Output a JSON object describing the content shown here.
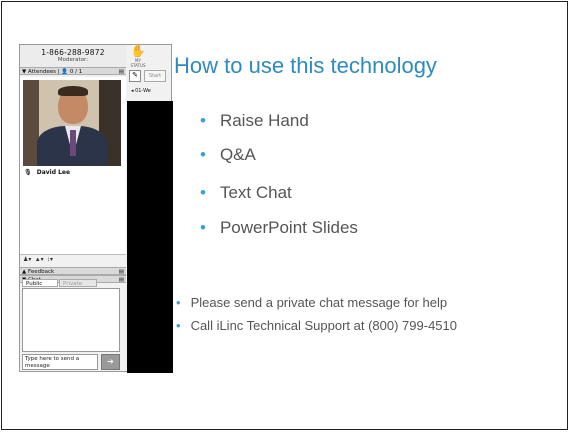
{
  "panel": {
    "phone": "1-866-288-9872",
    "phone_role": "Moderator:",
    "status_label": "MY STATUS",
    "start_label": "Start",
    "attendees_header": "▼ Attendees | 👤 0 / 1",
    "attendee_name": "David Lee",
    "feedback_header": "▲ Feedback",
    "chat_header": "▼ Chat",
    "tab_public": "Public",
    "tab_private": "Private",
    "chat_placeholder": "Type here to send a message",
    "slide_item": "01-We"
  },
  "slide": {
    "title": "How to use this technology",
    "bullets": [
      "Raise Hand",
      "Q&A",
      "Text Chat",
      "PowerPoint Slides"
    ],
    "notes": [
      "Please send a private chat message for help",
      "Call iLinc Technical Support at (800) 799-4510"
    ]
  },
  "colors": {
    "title": "#2e8bc0",
    "bullet_dot": "#3aa0d8",
    "text": "#555555"
  }
}
